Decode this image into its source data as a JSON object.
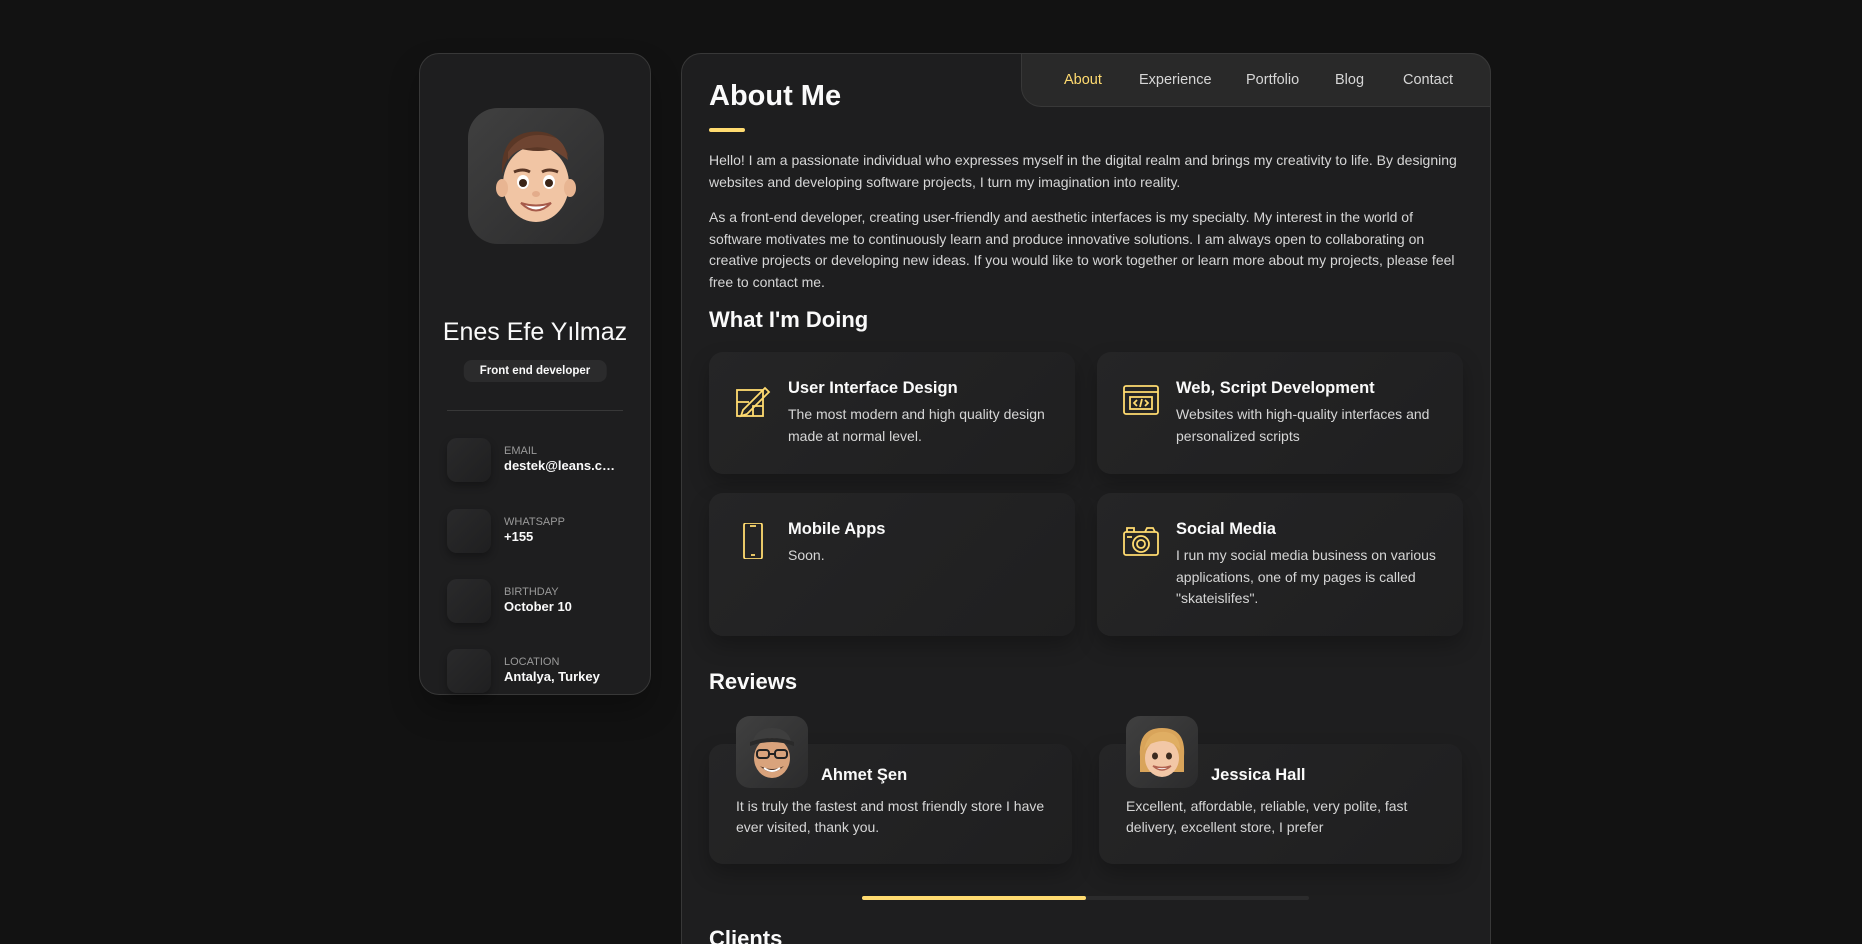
{
  "colors": {
    "accent": "#ffdb70",
    "background": "#121212",
    "card": "#1e1e1f"
  },
  "sidebar": {
    "name": "Enes Efe Yılmaz",
    "title": "Front end developer",
    "contacts": [
      {
        "label": "EMAIL",
        "value": "destek@leans.com"
      },
      {
        "label": "WHATSAPP",
        "value": "+155"
      },
      {
        "label": "BIRTHDAY",
        "value": "October 10"
      },
      {
        "label": "LOCATION",
        "value": "Antalya, Turkey"
      }
    ]
  },
  "nav": {
    "items": [
      "About",
      "Experience",
      "Portfolio",
      "Blog",
      "Contact"
    ],
    "active": "About"
  },
  "about": {
    "heading": "About Me",
    "paragraphs": [
      "Hello! I am a passionate individual who expresses myself in the digital realm and brings my creativity to life. By designing websites and developing software projects, I turn my imagination into reality.",
      "As a front-end developer, creating user-friendly and aesthetic interfaces is my specialty. My interest in the world of software motivates me to continuously learn and produce innovative solutions. I am always open to collaborating on creative projects or developing new ideas. If you would like to work together or learn more about my projects, please feel free to contact me."
    ]
  },
  "services": {
    "heading": "What I'm Doing",
    "items": [
      {
        "icon": "design-icon",
        "title": "User Interface Design",
        "text": "The most modern and high quality design made at normal level."
      },
      {
        "icon": "code-icon",
        "title": "Web, Script Development",
        "text": "Websites with high-quality interfaces and personalized scripts"
      },
      {
        "icon": "mobile-icon",
        "title": "Mobile Apps",
        "text": "Soon."
      },
      {
        "icon": "camera-icon",
        "title": "Social Media",
        "text": "I run my social media business on various applications, one of my pages is called \"skateislifes\"."
      }
    ]
  },
  "reviews": {
    "heading": "Reviews",
    "items": [
      {
        "name": "Ahmet Şen",
        "text": "It is truly the fastest and most friendly store I have ever visited, thank you."
      },
      {
        "name": "Jessica Hall",
        "text": "Excellent, affordable, reliable, very polite, fast delivery, excellent store, I prefer"
      }
    ],
    "scroll_progress": 0.5
  },
  "clients": {
    "heading": "Clients"
  }
}
